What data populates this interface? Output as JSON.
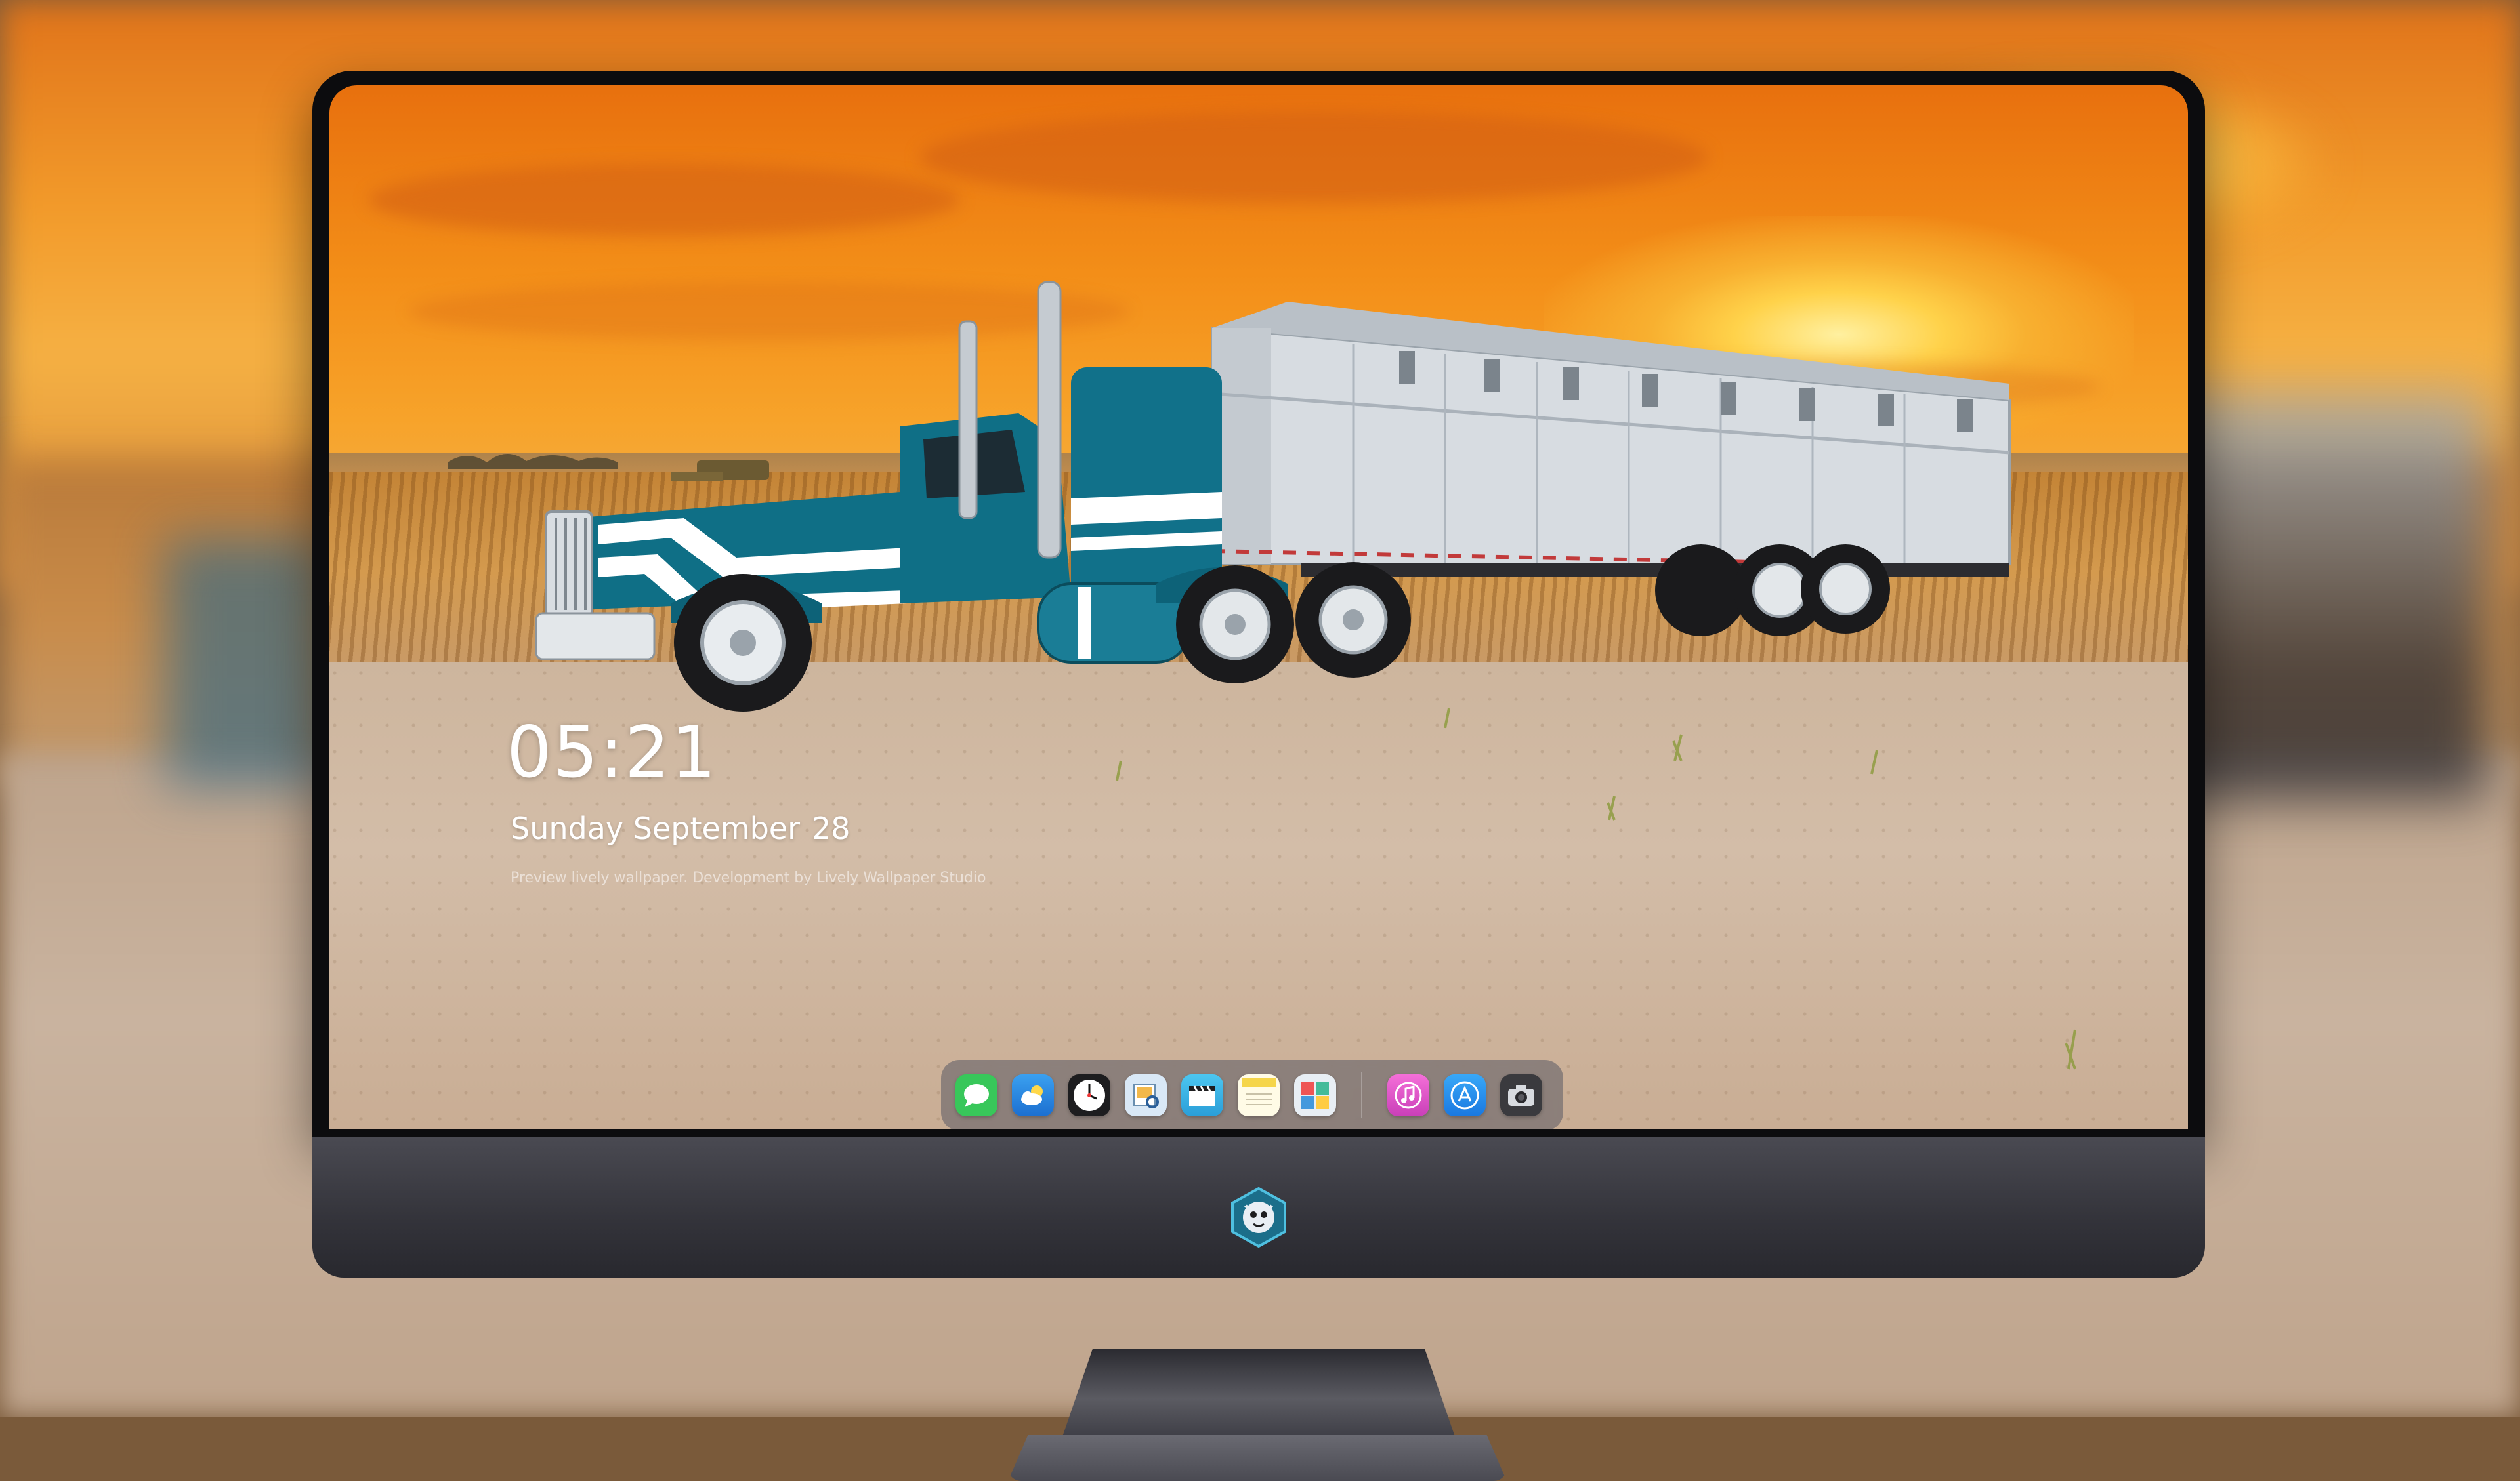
{
  "lockscreen": {
    "time": "05:21",
    "weekday_month": "Sunday September",
    "day": "28",
    "caption": "Preview lively wallpaper. Development by Lively Wallpaper Studio"
  },
  "dock": {
    "apps": [
      {
        "name": "Messages",
        "icon": "message-icon",
        "color": "#38c75a"
      },
      {
        "name": "Weather",
        "icon": "cloud-icon",
        "color": "#2f8be6"
      },
      {
        "name": "Clock",
        "icon": "clock-icon",
        "color": "#ffffff"
      },
      {
        "name": "Preview",
        "icon": "preview-icon",
        "color": "#d9e8f6"
      },
      {
        "name": "Clips",
        "icon": "clapperboard-icon",
        "color": "#39b6e6"
      },
      {
        "name": "Notes",
        "icon": "notes-icon",
        "color": "#f5d54a"
      },
      {
        "name": "Photo Booth",
        "icon": "photobooth-icon",
        "color": "#e8eef4"
      },
      {
        "name": "Music",
        "icon": "music-icon",
        "color": "#e555c9"
      },
      {
        "name": "App Store",
        "icon": "appstore-icon",
        "color": "#1f8ef1"
      },
      {
        "name": "Camera",
        "icon": "camera-icon",
        "color": "#3a3a3e"
      }
    ]
  },
  "colors": {
    "sky_top": "#e8700e",
    "sky_mid": "#f7a32a",
    "truck_blue": "#0f6f86",
    "trailer_silver": "#d8dde2",
    "bezel": "#0c0c0e",
    "chin": "#3a3a42"
  }
}
